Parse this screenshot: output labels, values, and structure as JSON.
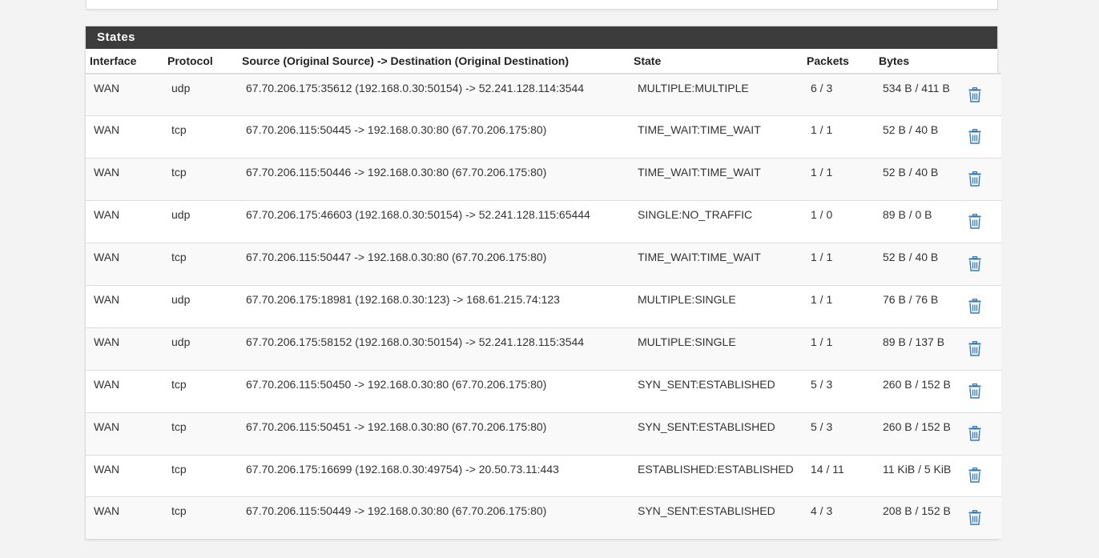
{
  "panel": {
    "title": "States"
  },
  "table": {
    "headers": {
      "interface": "Interface",
      "protocol": "Protocol",
      "source_dest": "Source (Original Source) -> Destination (Original Destination)",
      "state": "State",
      "packets": "Packets",
      "bytes": "Bytes"
    },
    "rows": [
      {
        "interface": "WAN",
        "protocol": "udp",
        "source_dest": "67.70.206.175:35612 (192.168.0.30:50154) -> 52.241.128.114:3544",
        "state": "MULTIPLE:MULTIPLE",
        "packets": "6 / 3",
        "bytes": "534 B / 411 B"
      },
      {
        "interface": "WAN",
        "protocol": "tcp",
        "source_dest": "67.70.206.115:50445 -> 192.168.0.30:80 (67.70.206.175:80)",
        "state": "TIME_WAIT:TIME_WAIT",
        "packets": "1 / 1",
        "bytes": "52 B / 40 B"
      },
      {
        "interface": "WAN",
        "protocol": "tcp",
        "source_dest": "67.70.206.115:50446 -> 192.168.0.30:80 (67.70.206.175:80)",
        "state": "TIME_WAIT:TIME_WAIT",
        "packets": "1 / 1",
        "bytes": "52 B / 40 B"
      },
      {
        "interface": "WAN",
        "protocol": "udp",
        "source_dest": "67.70.206.175:46603 (192.168.0.30:50154) -> 52.241.128.115:65444",
        "state": "SINGLE:NO_TRAFFIC",
        "packets": "1 / 0",
        "bytes": "89 B / 0 B"
      },
      {
        "interface": "WAN",
        "protocol": "tcp",
        "source_dest": "67.70.206.115:50447 -> 192.168.0.30:80 (67.70.206.175:80)",
        "state": "TIME_WAIT:TIME_WAIT",
        "packets": "1 / 1",
        "bytes": "52 B / 40 B"
      },
      {
        "interface": "WAN",
        "protocol": "udp",
        "source_dest": "67.70.206.175:18981 (192.168.0.30:123) -> 168.61.215.74:123",
        "state": "MULTIPLE:SINGLE",
        "packets": "1 / 1",
        "bytes": "76 B / 76 B"
      },
      {
        "interface": "WAN",
        "protocol": "udp",
        "source_dest": "67.70.206.175:58152 (192.168.0.30:50154) -> 52.241.128.115:3544",
        "state": "MULTIPLE:SINGLE",
        "packets": "1 / 1",
        "bytes": "89 B / 137 B"
      },
      {
        "interface": "WAN",
        "protocol": "tcp",
        "source_dest": "67.70.206.115:50450 -> 192.168.0.30:80 (67.70.206.175:80)",
        "state": "SYN_SENT:ESTABLISHED",
        "packets": "5 / 3",
        "bytes": "260 B / 152 B"
      },
      {
        "interface": "WAN",
        "protocol": "tcp",
        "source_dest": "67.70.206.115:50451 -> 192.168.0.30:80 (67.70.206.175:80)",
        "state": "SYN_SENT:ESTABLISHED",
        "packets": "5 / 3",
        "bytes": "260 B / 152 B"
      },
      {
        "interface": "WAN",
        "protocol": "tcp",
        "source_dest": "67.70.206.175:16699 (192.168.0.30:49754) -> 20.50.73.11:443",
        "state": "ESTABLISHED:ESTABLISHED",
        "packets": "14 / 11",
        "bytes": "11 KiB / 5 KiB"
      },
      {
        "interface": "WAN",
        "protocol": "tcp",
        "source_dest": "67.70.206.115:50449 -> 192.168.0.30:80 (67.70.206.175:80)",
        "state": "SYN_SENT:ESTABLISHED",
        "packets": "4 / 3",
        "bytes": "208 B / 152 B"
      }
    ]
  },
  "icons": {
    "delete": "trash-icon"
  },
  "colors": {
    "heading_bg": "#3c3c3c",
    "trash_icon": "#337ab7"
  }
}
